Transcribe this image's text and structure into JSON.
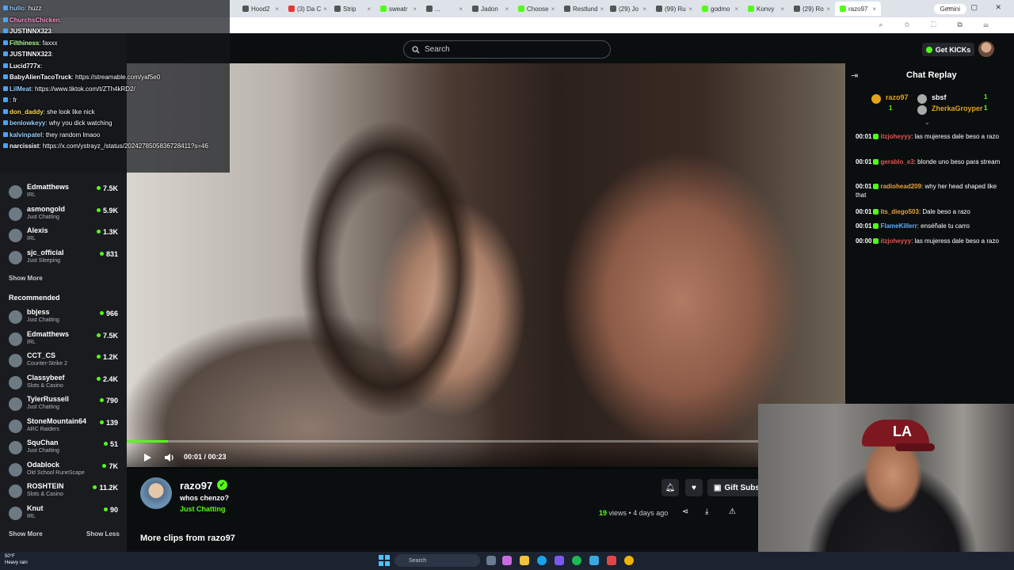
{
  "browser": {
    "tabs": [
      {
        "label": "Hood2",
        "icon": "x"
      },
      {
        "label": "(3) Da C",
        "icon": "youtube"
      },
      {
        "label": "Strip",
        "icon": "x"
      },
      {
        "label": "sweatr",
        "icon": "kick"
      },
      {
        "label": "...",
        "icon": "x"
      },
      {
        "label": "Jadon",
        "icon": "x"
      },
      {
        "label": "Choose",
        "icon": "kick"
      },
      {
        "label": "Restlund",
        "icon": "x"
      },
      {
        "label": "(29) Jo",
        "icon": "x"
      },
      {
        "label": "(99) Ru",
        "icon": "x"
      },
      {
        "label": "godmo",
        "icon": "kick"
      },
      {
        "label": "Konvy",
        "icon": "kick"
      },
      {
        "label": "(29) Ro",
        "icon": "x"
      },
      {
        "label": "razo97",
        "icon": "kick",
        "active": true
      }
    ],
    "gemini_label": "Gemini"
  },
  "kick": {
    "search_placeholder": "Search",
    "get_kicks_label": "Get KICKs"
  },
  "sidebar": {
    "following_channels": [
      {
        "name": "Edmatthews",
        "category": "IRL",
        "viewers": "7.5K"
      },
      {
        "name": "asmongold",
        "category": "Just Chatting",
        "viewers": "5.9K"
      },
      {
        "name": "Alexis",
        "category": "IRL",
        "viewers": "1.3K"
      },
      {
        "name": "sjc_official",
        "category": "Just Sleeping",
        "viewers": "831"
      }
    ],
    "show_more_1": "Show More",
    "recommended_heading": "Recommended",
    "recommended": [
      {
        "name": "bbjess",
        "category": "Just Chatting",
        "viewers": "966"
      },
      {
        "name": "Edmatthews",
        "category": "IRL",
        "viewers": "7.5K"
      },
      {
        "name": "CCT_CS",
        "category": "Counter-Strike 2",
        "viewers": "1.2K"
      },
      {
        "name": "Classybeef",
        "category": "Slots & Casino",
        "viewers": "2.4K"
      },
      {
        "name": "TylerRussell",
        "category": "Just Chatting",
        "viewers": "790"
      },
      {
        "name": "StoneMountain64",
        "category": "ARC Raiders",
        "viewers": "139"
      },
      {
        "name": "SquChan",
        "category": "Just Chatting",
        "viewers": "51"
      },
      {
        "name": "Odablock",
        "category": "Old School RuneScape",
        "viewers": "7K"
      },
      {
        "name": "ROSHTEIN",
        "category": "Slots & Casino",
        "viewers": "11.2K"
      },
      {
        "name": "Knut",
        "category": "IRL",
        "viewers": "90"
      }
    ],
    "show_more_2": "Show More",
    "show_less": "Show Less"
  },
  "overlay_chat": [
    {
      "user": "hullo",
      "text": "huzz",
      "color": "#9ad0ff"
    },
    {
      "user": "ChurchsChicken",
      "text": "",
      "color": "#ff9ad0"
    },
    {
      "user": "JUSTINNX323",
      "text": "",
      "color": "#ffffff"
    },
    {
      "user": "Filthiness",
      "text": "faxxx",
      "color": "#b4ff9a"
    },
    {
      "user": "JUSTINNX323",
      "text": "",
      "color": "#ffffff"
    },
    {
      "user": "Lucid777x",
      "text": "",
      "color": "#ffffff"
    },
    {
      "user": "BabyAlienTacoTruck",
      "text": "https://streamable.com/yaf5e0",
      "color": "#ffffff"
    },
    {
      "user": "LilMeat",
      "text": "https://www.tiktok.com/t/ZTh4kRD2/",
      "color": "#9ad0ff"
    },
    {
      "user": "",
      "text": "fr",
      "color": "#ffffff"
    },
    {
      "user": "don_daddy",
      "text": "she look like nick",
      "color": "#ffdc5a"
    },
    {
      "user": "benlowkeyy",
      "text": "why you dick watching",
      "color": "#9ad0ff"
    },
    {
      "user": "kalvinpatel",
      "text": "they random lmaoo",
      "color": "#9ad0ff"
    },
    {
      "user": "narcissist",
      "text": "https://x.com/ystrayz_/status/2024278505836728411?s=46",
      "color": "#ffffff"
    }
  ],
  "video": {
    "time_current": "00:01",
    "time_total": "00:23",
    "time_display": "00:01 / 00:23",
    "progress_fraction": 0.065
  },
  "clip": {
    "streamer": "razo97",
    "title": "whos chenzo?",
    "category": "Just Chatting",
    "views_count": "19",
    "views_suffix": "views • 4 days ago",
    "gift_subs_label": "Gift Subs",
    "more_clips": "More clips from razo97"
  },
  "chat_replay": {
    "title": "Chat Replay",
    "gifters": [
      {
        "name": "razo97",
        "count": "1",
        "color": "#e3a41a"
      },
      {
        "name": "sbsf",
        "count": "1",
        "color": "#ffffff"
      },
      {
        "name": "ZherkaGroyper",
        "count": "1",
        "color": "#e3a41a"
      }
    ],
    "gifter_extra_count": "1",
    "messages": [
      {
        "time": "00:01",
        "user": "itzjoheyyy",
        "text": "las mujeress dale beso a razo",
        "color": "#e05555"
      },
      {
        "time": "00:01",
        "user": "gerablo_e3",
        "text": "blonde uno beso para stream",
        "color": "#e05555"
      },
      {
        "time": "00:01",
        "user": "radiohead209",
        "text": "why her head shaped like that",
        "color": "#e8a23d"
      },
      {
        "time": "00:01",
        "user": "its_diego503",
        "text": "Dale beso a razo",
        "color": "#e8a23d"
      },
      {
        "time": "00:01",
        "user": "FlameKillerr",
        "text": "enséñale tu carro",
        "color": "#5fb0ff"
      },
      {
        "time": "00:00",
        "user": "itzjoheyyy",
        "text": "las mujeress dale beso a razo",
        "color": "#e05555"
      }
    ]
  },
  "taskbar": {
    "weather_temp": "50°F",
    "weather_desc": "Heavy rain",
    "search_placeholder": "Search"
  },
  "colors": {
    "kick_green": "#53fc18",
    "background": "#0b0e0f",
    "sidebar": "#191b1f"
  }
}
